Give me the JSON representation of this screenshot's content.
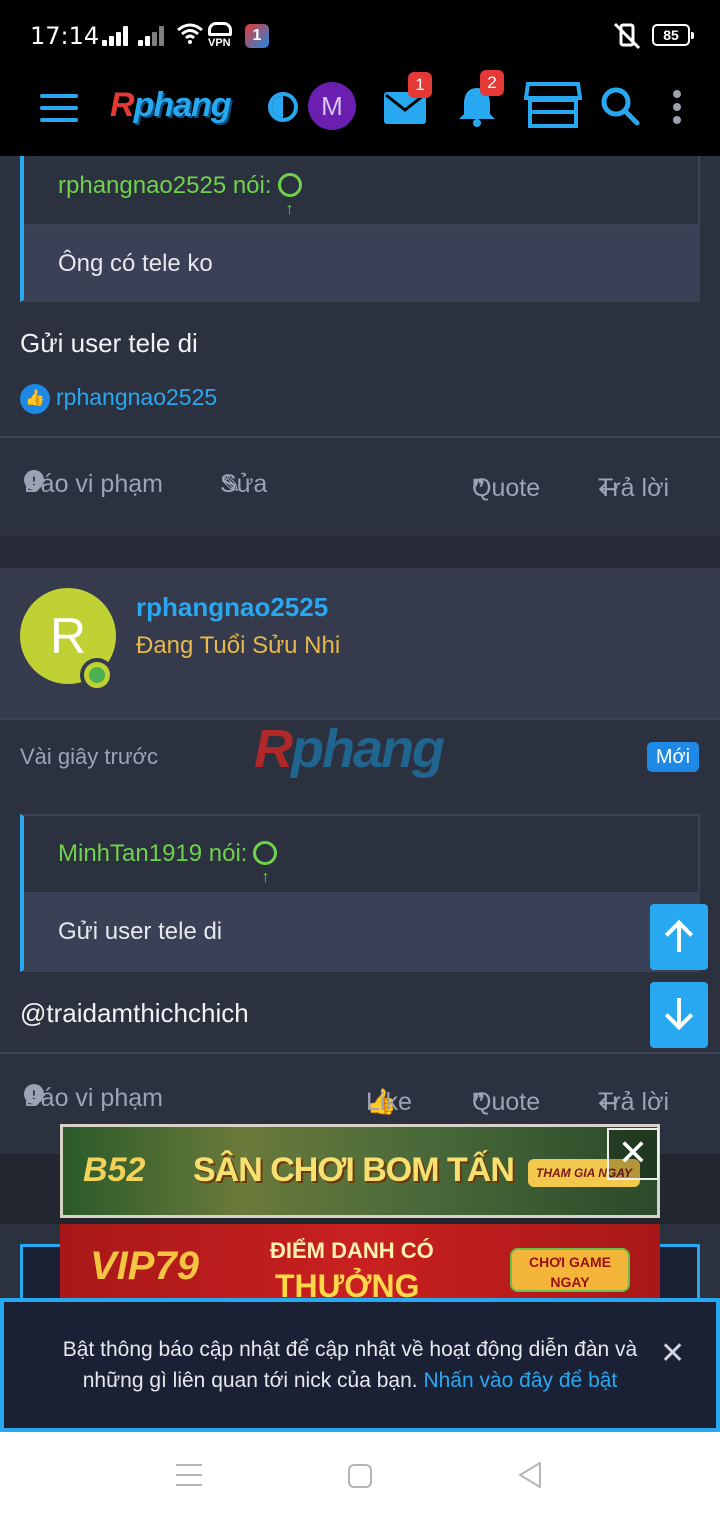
{
  "status_bar": {
    "time": "17:14",
    "vpn": "VPN",
    "app_badge": "1",
    "battery": "85"
  },
  "nav": {
    "logo_r": "R",
    "logo_rest": "phang",
    "avatar_letter": "M",
    "messages_badge": "1",
    "alerts_badge": "2",
    "accent": "#29a8f2"
  },
  "post1": {
    "quote_author": "rphangnao2525 nói:",
    "quote_text": "Ông có tele ko",
    "body": "Gửi user tele di",
    "liked_by": "rphangnao2525",
    "actions": {
      "report": "Báo vi phạm",
      "edit": "Sửa",
      "quote": "Quote",
      "reply": "Trả lời"
    }
  },
  "post2": {
    "author": "rphangnao2525",
    "author_initial": "R",
    "author_title": "Đang Tuổi Sửu Nhi",
    "time": "Vài giây trước",
    "new_badge": "Mới",
    "watermark_r": "R",
    "watermark_rest": "phang",
    "quote_author": "MinhTan1919 nói:",
    "quote_text": "Gửi user tele di",
    "body": "@traidamthichchich",
    "actions": {
      "report": "Báo vi phạm",
      "like": "Like",
      "quote": "Quote",
      "reply": "Trả lời"
    }
  },
  "ads": {
    "ad1_brand": "B52",
    "ad1_text": "SÂN CHƠI BOM TẤN",
    "ad1_button": "THAM GIA NGAY",
    "ad1_close": "✕",
    "ad2_brand": "VIP79",
    "ad2_line1": "ĐIỂM DANH CÓ",
    "ad2_line2": "THƯỞNG",
    "ad2_button": "CHƠI GAME NGAY"
  },
  "notification": {
    "message": "Bật thông báo cập nhật để cập nhật về hoạt động diễn đàn và những gì liên quan tới nick của bạn.",
    "link": "Nhấn vào đây để bật",
    "close": "✕"
  }
}
